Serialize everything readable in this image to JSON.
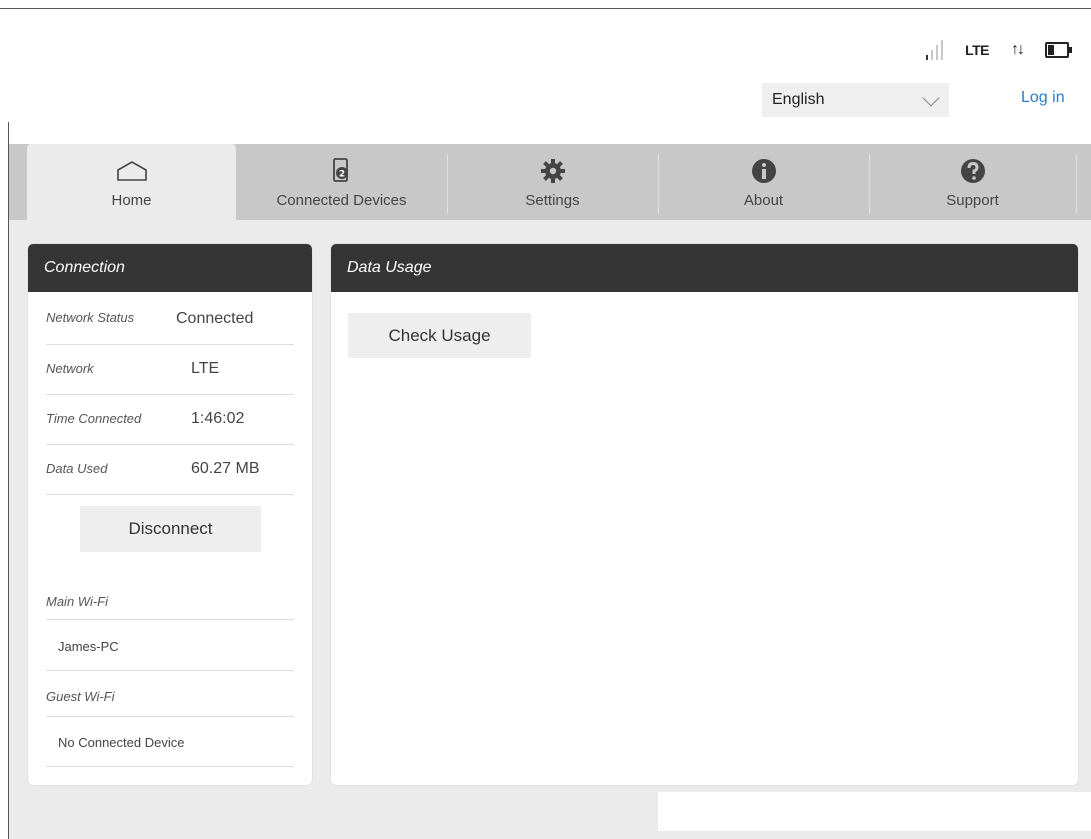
{
  "status": {
    "network_type": "LTE",
    "signal_bars_on": 1,
    "signal_bars_total": 4,
    "data_activity": "↑↓",
    "battery_level": 0.3
  },
  "header": {
    "language_selected": "English",
    "login_label": "Log in"
  },
  "tabs": [
    {
      "label": "Home",
      "icon": "home-icon"
    },
    {
      "label": "Connected Devices",
      "icon": "connected-devices-icon"
    },
    {
      "label": "Settings",
      "icon": "gear-icon"
    },
    {
      "label": "About",
      "icon": "info-icon"
    },
    {
      "label": "Support",
      "icon": "help-icon"
    }
  ],
  "connection": {
    "title": "Connection",
    "rows": [
      {
        "key": "Network Status",
        "value": "Connected"
      },
      {
        "key": "Network",
        "value": "LTE"
      },
      {
        "key": "Time Connected",
        "value": "1:46:02"
      },
      {
        "key": "Data Used",
        "value": "60.27 MB"
      }
    ],
    "disconnect_label": "Disconnect",
    "main_wifi_label": "Main Wi-Fi",
    "main_wifi_device": "James-PC",
    "guest_wifi_label": "Guest Wi-Fi",
    "guest_wifi_device": "No Connected Device"
  },
  "usage": {
    "title": "Data Usage",
    "check_label": "Check Usage"
  }
}
